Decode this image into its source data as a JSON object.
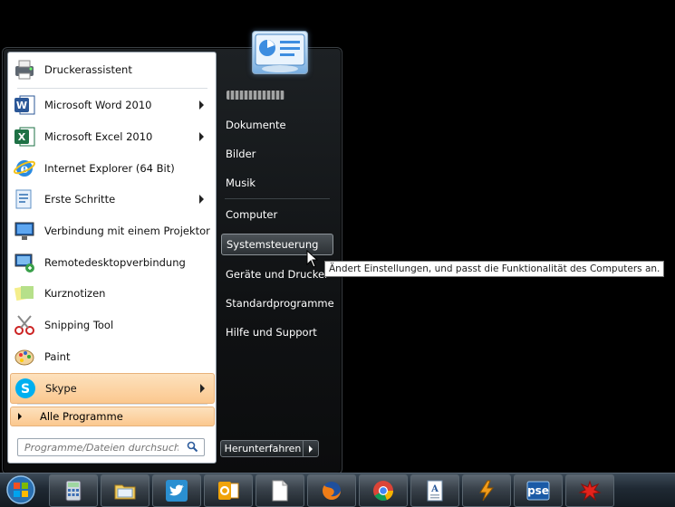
{
  "start_menu": {
    "programs": [
      {
        "label": "Druckerassistent",
        "icon": "printer-wizard-icon",
        "has_submenu": false
      },
      {
        "label": "Microsoft Word 2010",
        "icon": "word-icon",
        "has_submenu": true
      },
      {
        "label": "Microsoft Excel 2010",
        "icon": "excel-icon",
        "has_submenu": true
      },
      {
        "label": "Internet Explorer (64 Bit)",
        "icon": "internet-explorer-icon",
        "has_submenu": false
      },
      {
        "label": "Erste Schritte",
        "icon": "getting-started-icon",
        "has_submenu": true
      },
      {
        "label": "Verbindung mit einem Projektor",
        "icon": "projector-icon",
        "has_submenu": false
      },
      {
        "label": "Remotedesktopverbindung",
        "icon": "remote-desktop-icon",
        "has_submenu": false
      },
      {
        "label": "Kurznotizen",
        "icon": "sticky-notes-icon",
        "has_submenu": false
      },
      {
        "label": "Snipping Tool",
        "icon": "scissors-icon",
        "has_submenu": false
      },
      {
        "label": "Paint",
        "icon": "paint-palette-icon",
        "has_submenu": false
      },
      {
        "label": "Skype",
        "icon": "skype-icon",
        "has_submenu": true
      }
    ],
    "all_programs_label": "Alle Programme",
    "search_placeholder": "Programme/Dateien durchsuchen",
    "right_items": [
      {
        "label": "Dokumente"
      },
      {
        "label": "Bilder"
      },
      {
        "label": "Musik"
      },
      {
        "label": "Computer"
      },
      {
        "label": "Systemsteuerung"
      },
      {
        "label": "Geräte und Drucker"
      },
      {
        "label": "Standardprogramme"
      },
      {
        "label": "Hilfe und Support"
      }
    ],
    "shutdown_label": "Herunterfahren",
    "tooltip": "Ändert Einstellungen, und passt die Funktionalität des Computers an."
  },
  "taskbar": {
    "buttons": [
      {
        "icon": "calculator-icon"
      },
      {
        "icon": "file-explorer-icon"
      },
      {
        "icon": "twitter-icon"
      },
      {
        "icon": "outlook-icon"
      },
      {
        "icon": "blank-document-icon"
      },
      {
        "icon": "firefox-icon"
      },
      {
        "icon": "chrome-icon"
      },
      {
        "icon": "text-document-icon"
      },
      {
        "icon": "winamp-icon"
      },
      {
        "icon": "photoshop-elements-icon",
        "text": "pse"
      },
      {
        "icon": "red-splat-icon"
      }
    ]
  },
  "colors": {
    "highlight": "#fbc88f",
    "panel_dark": "#101214"
  }
}
